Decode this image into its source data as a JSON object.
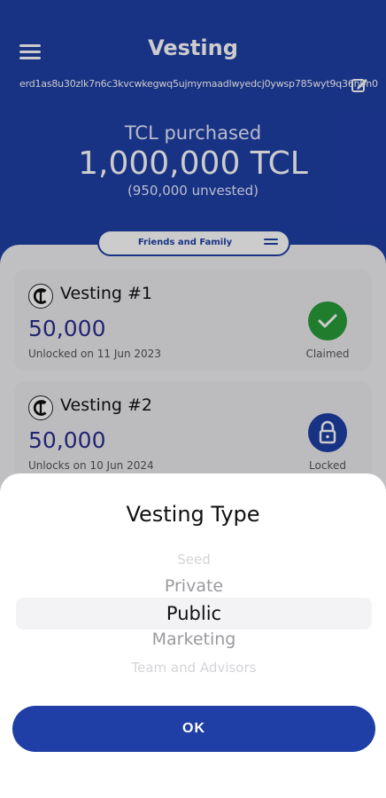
{
  "header": {
    "title": "Vesting",
    "wallet_address": "erd1as8u30zlk7n6c3kvcwkegwq5ujmymaadlwyedcj0ywsp785wyt9q36h0n0",
    "purchased_label": "TCL purchased",
    "purchased_amount": "1,000,000 TCL",
    "unvested": "(950,000 unvested)"
  },
  "filter": {
    "label": "Friends and Family"
  },
  "vestings": [
    {
      "title": "Vesting #1",
      "amount": "50,000",
      "date": "Unlocked on 11 Jun 2023",
      "status": "Claimed",
      "status_icon": "check-icon",
      "status_color": "#2a9d3a"
    },
    {
      "title": "Vesting #2",
      "amount": "50,000",
      "date": "Unlocks on 10 Jun 2024",
      "status": "Locked",
      "status_icon": "lock-icon",
      "status_color": "#1f3fa6"
    }
  ],
  "sheet": {
    "title": "Vesting Type",
    "options": [
      "Seed",
      "Private",
      "Public",
      "Marketing",
      "Team and Advisors"
    ],
    "selected": "Public",
    "ok_label": "OK"
  },
  "colors": {
    "primary": "#1f3fa6",
    "claimed": "#2a9d3a"
  }
}
